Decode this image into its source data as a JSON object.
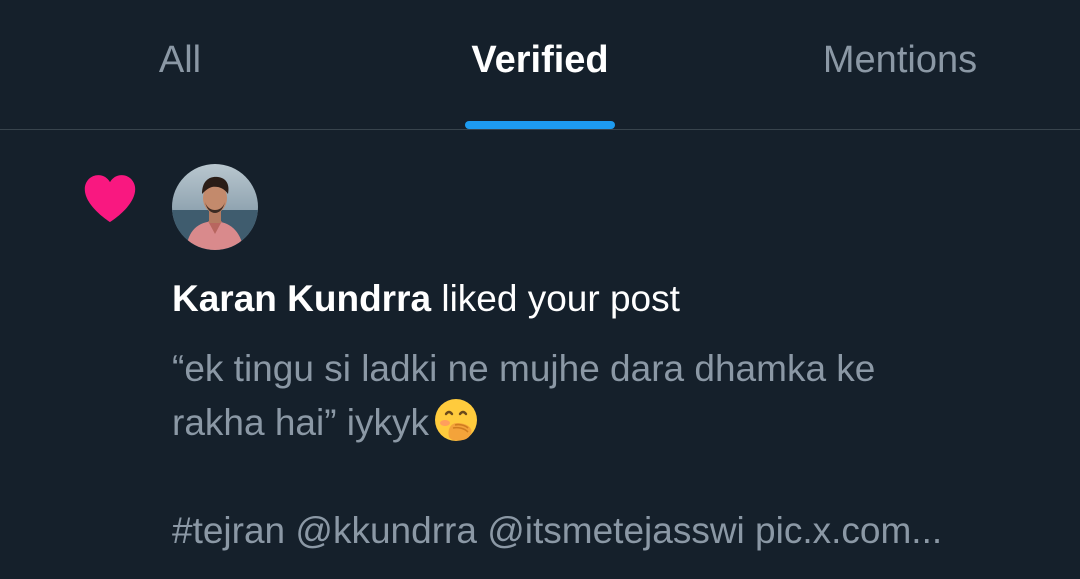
{
  "tabs": [
    {
      "label": "All",
      "active": false
    },
    {
      "label": "Verified",
      "active": true
    },
    {
      "label": "Mentions",
      "active": false
    }
  ],
  "notification": {
    "icon": "heart-icon",
    "user_name": "Karan Kundrra",
    "action_text": "liked your post",
    "post_line1": "“ek tingu si ladki ne mujhe dara dhamka ke",
    "post_line2": "rakha hai” iykyk",
    "post_emoji": "hand-over-mouth-emoji",
    "post_line3": "#tejran @kkundrra @itsmetejasswi pic.x.com..."
  },
  "colors": {
    "background": "#15202b",
    "accent": "#1d9bf0",
    "heart": "#f91880",
    "muted_text": "#8b98a5",
    "divider": "#38444d"
  }
}
